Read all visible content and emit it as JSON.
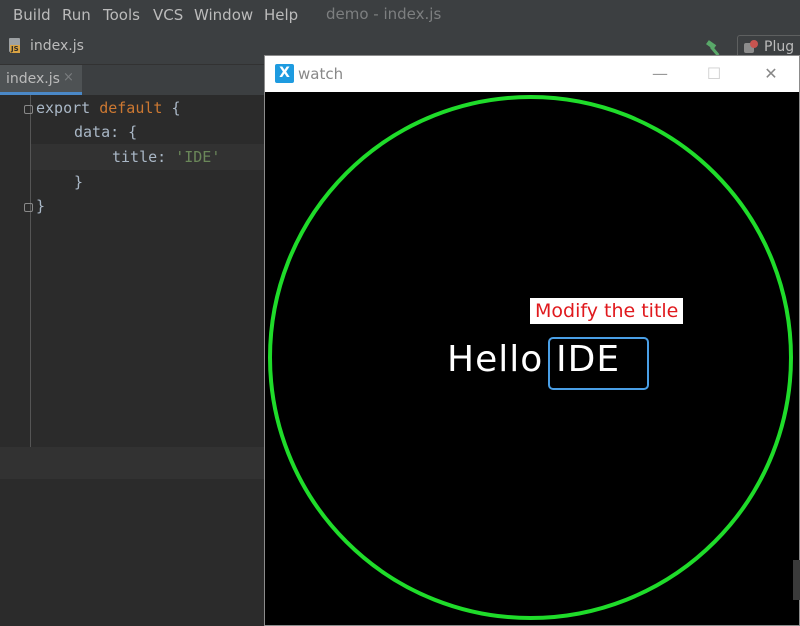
{
  "menu": {
    "items": [
      "Build",
      "Run",
      "Tools",
      "VCS",
      "Window",
      "Help"
    ],
    "window_title": "demo - index.js"
  },
  "navbar": {
    "file": "index.js",
    "plugin_label": "Plug"
  },
  "tabs": [
    {
      "label": "index.js",
      "close": "×"
    }
  ],
  "code": {
    "line1_a": "export ",
    "line1_kw": "default",
    "line1_b": " {",
    "line2": "data: {",
    "line3_key": "title: ",
    "line3_val": "'IDE'",
    "line4": "}",
    "line5": "}"
  },
  "watch": {
    "window_title": "watch",
    "logo": "X",
    "minimize": "—",
    "maximize": "☐",
    "close": "✕",
    "hello": "Hello",
    "title_value": "IDE",
    "callout": "Modify the title"
  },
  "colors": {
    "ring": "#1fdc2a",
    "highlight_box": "#4a9fe6",
    "callout_text": "#e0191d"
  }
}
